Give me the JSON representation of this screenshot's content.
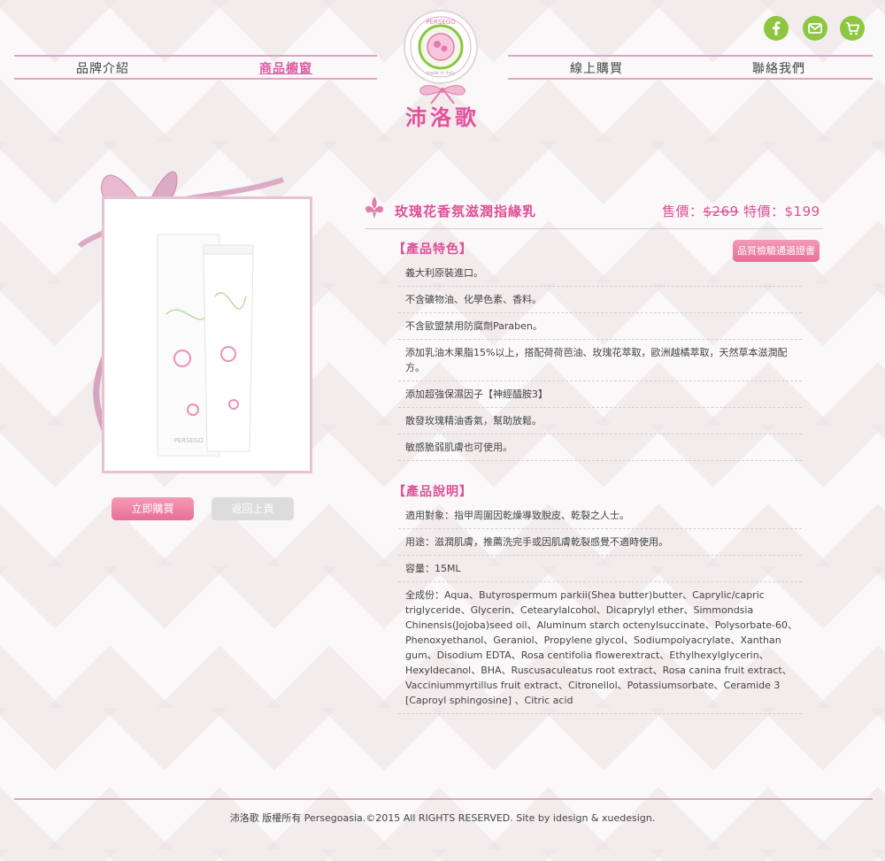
{
  "nav": {
    "brand_intro": "品牌介紹",
    "product_window": "商品櫥窗",
    "online_shop": "線上購買",
    "contact": "聯絡我們"
  },
  "social": {
    "facebook": "facebook-icon",
    "mail": "mail-icon",
    "cart": "cart-icon",
    "color": "#8dc63f"
  },
  "logo": {
    "ring_text": "PERSEGO",
    "made_text": "made in Italy",
    "brand_cn": "沛洛歌"
  },
  "product": {
    "name": "玫瑰花香氛滋潤指緣乳",
    "price_label": "售價：",
    "original_price": "$269",
    "special_label": " 特價：",
    "special_price": "$199",
    "box_brand": "PERSEGO",
    "buy_button": "立即購買",
    "back_button": "返回上頁"
  },
  "features": {
    "heading": "【產品特色】",
    "cert_button": "品質檢驗通過證書",
    "items": [
      "義大利原裝進口。",
      "不含礦物油、化學色素、香料。",
      "不含歐盟禁用防腐劑Paraben。",
      "添加乳油木果脂15%以上，搭配荷荷芭油、玫瑰花萃取，歐洲越橘萃取，天然草本滋潤配方。",
      "添加超強保濕因子【神經醯胺3】",
      "散發玫瑰精油香氣，幫助放鬆。",
      "敏感脆弱肌膚也可使用。"
    ]
  },
  "description": {
    "heading": "【產品說明】",
    "items": [
      "適用對象：指甲周圍因乾燥導致脫皮、乾裂之人士。",
      "用途：滋潤肌膚，推薦洗完手或因肌膚乾裂感覺不適時使用。",
      "容量：15ML",
      "全成份：Aqua、Butyrospermum parkii(Shea butter)butter、Caprylic/capric triglyceride、Glycerin、Cetearylalcohol、Dicaprylyl ether、Simmondsia Chinensis(Jojoba)seed oil、Aluminum starch octenylsuccinate、Polysorbate-60、Phenoxyethanol、Geraniol、Propylene glycol、Sodiumpolyacrylate、Xanthan gum、Disodium EDTA、Rosa centifolia flowerextract、Ethylhexylglycerin、Hexyldecanol、BHA、Ruscusaculeatus root extract、Rosa canina fruit extract、Vacciniummyrtillus fruit extract、Citronellol、Potassiumsorbate、Ceramide 3 [Caproyl sphingosine] 、Citric acid"
    ]
  },
  "footer": {
    "text": "沛洛歌 版權所有 Persegoasia.©2015 All RIGHTS RESERVED. Site by idesign & xuedesign."
  },
  "colors": {
    "accent_pink": "#e04e97",
    "nav_line": "#d8a6c6",
    "green": "#8dc63f"
  }
}
